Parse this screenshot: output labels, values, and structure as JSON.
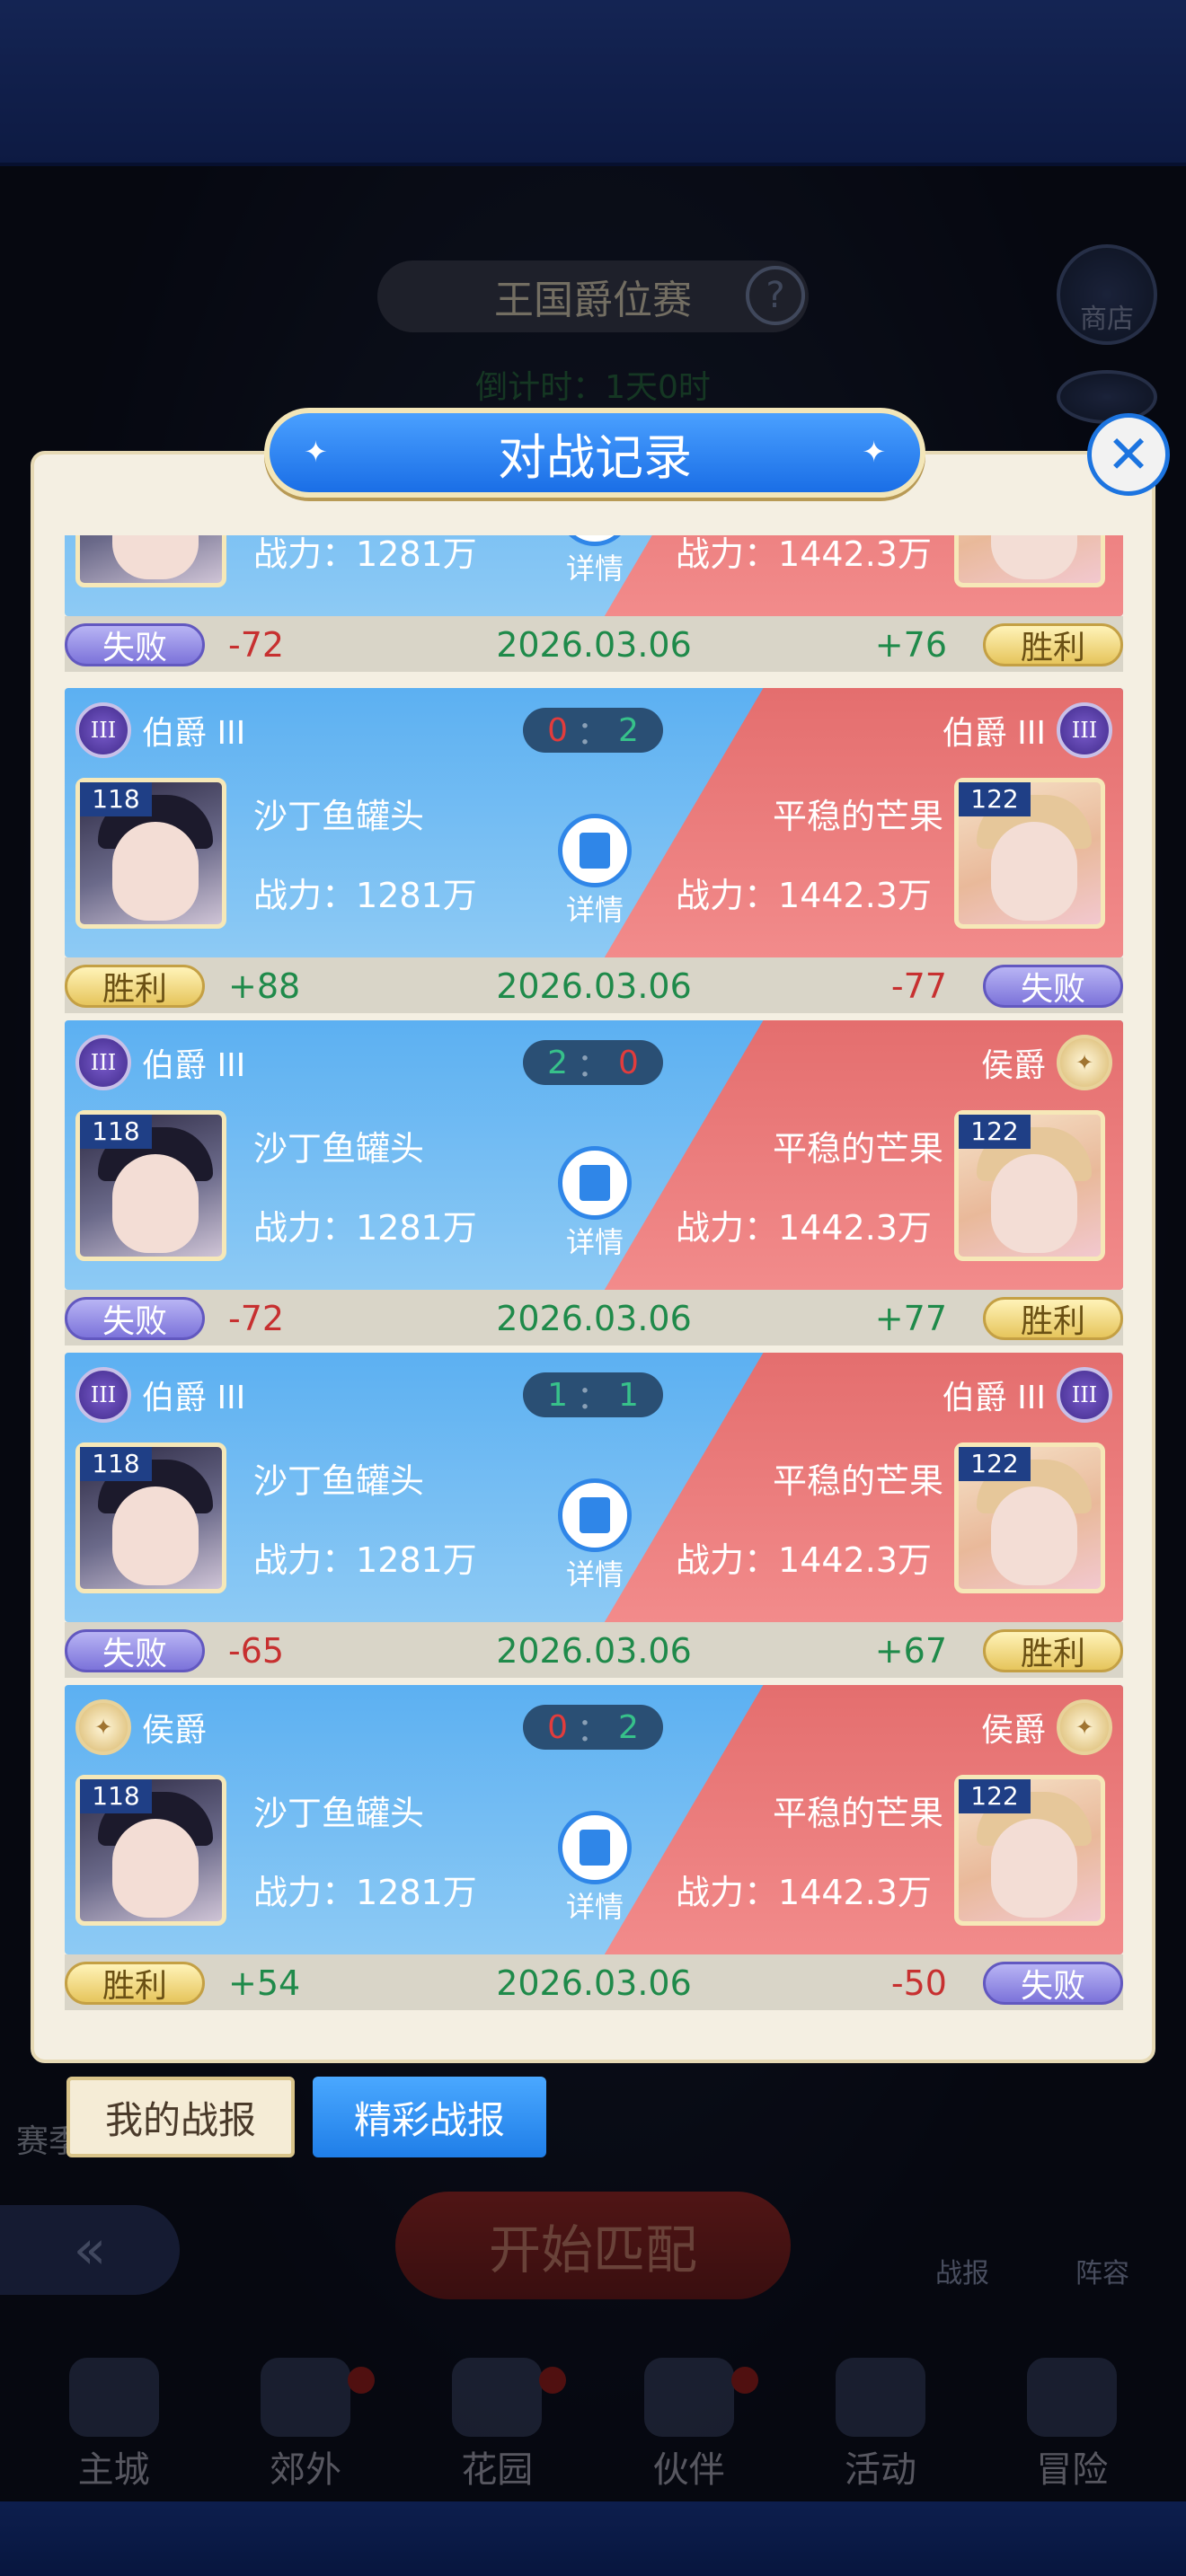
{
  "background": {
    "event_title": "王国爵位赛",
    "help_label": "?",
    "countdown": "倒计时：1天0时",
    "shop_label": "商店",
    "start_match_label": "开始匹配",
    "battle_report_label": "战报",
    "lineup_label": "阵容",
    "side_label": "赛季"
  },
  "nav": {
    "items": [
      {
        "label": "主城"
      },
      {
        "label": "郊外"
      },
      {
        "label": "花园"
      },
      {
        "label": "伙伴"
      },
      {
        "label": "活动"
      },
      {
        "label": "冒险"
      }
    ]
  },
  "dialog": {
    "title": "对战记录",
    "close_label": "✕",
    "detail_label": "详情",
    "power_prefix": "战力：",
    "tabs": {
      "mine": "我的战报",
      "highlights": "精彩战报"
    },
    "records": [
      {
        "left": {
          "rank": "",
          "level": "",
          "name": "",
          "power": "1281万",
          "result": "失败",
          "delta": "-72"
        },
        "right": {
          "rank": "",
          "level": "",
          "name": "",
          "power": "1442.3万",
          "result": "胜利",
          "delta": "+76"
        },
        "score": {
          "left": "",
          "sep": "",
          "right": ""
        },
        "date": "2026.03.06"
      },
      {
        "left": {
          "rank": "伯爵 III",
          "badge": "III",
          "level": "118",
          "name": "沙丁鱼罐头",
          "power": "1281万",
          "result": "胜利",
          "delta": "+88"
        },
        "right": {
          "rank": "伯爵 III",
          "badge": "III",
          "level": "122",
          "name": "平稳的芒果",
          "power": "1442.3万",
          "result": "失败",
          "delta": "-77"
        },
        "score": {
          "left": "0",
          "sep": "：",
          "right": "2"
        },
        "date": "2026.03.06"
      },
      {
        "left": {
          "rank": "伯爵 III",
          "badge": "III",
          "level": "118",
          "name": "沙丁鱼罐头",
          "power": "1281万",
          "result": "失败",
          "delta": "-72"
        },
        "right": {
          "rank": "侯爵",
          "badge": "",
          "level": "122",
          "name": "平稳的芒果",
          "power": "1442.3万",
          "result": "胜利",
          "delta": "+77"
        },
        "score": {
          "left": "2",
          "sep": "：",
          "right": "0"
        },
        "date": "2026.03.06"
      },
      {
        "left": {
          "rank": "伯爵 III",
          "badge": "III",
          "level": "118",
          "name": "沙丁鱼罐头",
          "power": "1281万",
          "result": "失败",
          "delta": "-65"
        },
        "right": {
          "rank": "伯爵 III",
          "badge": "III",
          "level": "122",
          "name": "平稳的芒果",
          "power": "1442.3万",
          "result": "胜利",
          "delta": "+67"
        },
        "score": {
          "left": "1",
          "sep": "：",
          "right": "1"
        },
        "date": "2026.03.06"
      },
      {
        "left": {
          "rank": "侯爵",
          "badge": "",
          "level": "118",
          "name": "沙丁鱼罐头",
          "power": "1281万",
          "result": "胜利",
          "delta": "+54"
        },
        "right": {
          "rank": "侯爵",
          "badge": "",
          "level": "122",
          "name": "平稳的芒果",
          "power": "1442.3万",
          "result": "失败",
          "delta": "-50"
        },
        "score": {
          "left": "0",
          "sep": "：",
          "right": "2"
        },
        "date": "2026.03.06"
      }
    ]
  }
}
